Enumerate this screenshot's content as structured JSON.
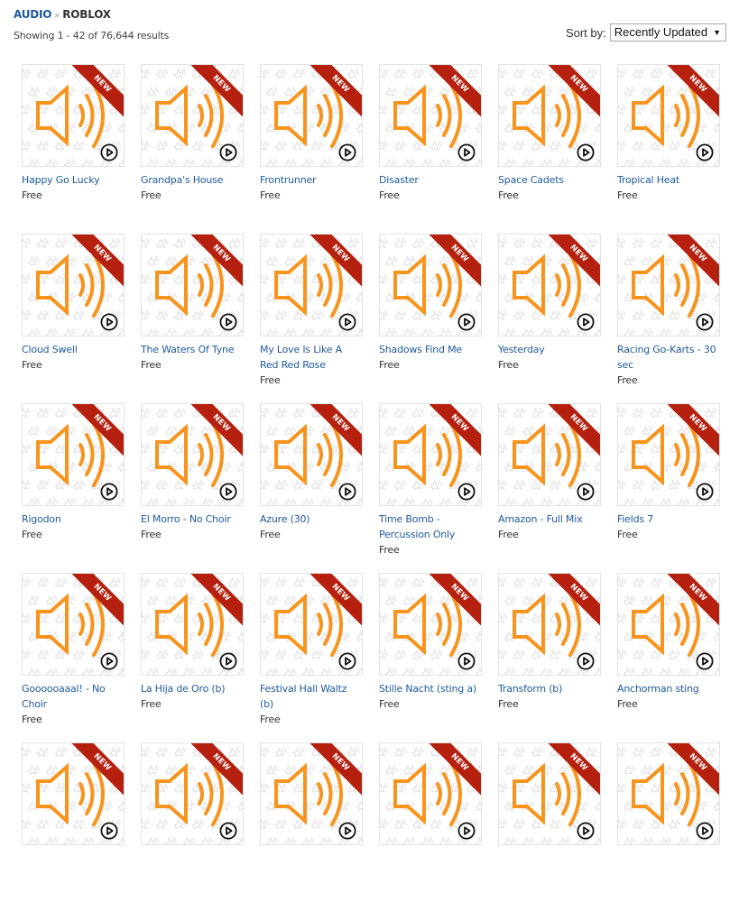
{
  "breadcrumb": {
    "parent": "AUDIO",
    "separator": "»",
    "current": "ROBLOX"
  },
  "results": {
    "text": "Showing 1 - 42 of 76,644 results"
  },
  "sort": {
    "label": "Sort by:",
    "selected": "Recently Updated",
    "arrow": "▼"
  },
  "badge_label": "NEW",
  "colors": {
    "link": "#1e5a9c",
    "ribbon": "#b5200f",
    "speaker": "#f7941d"
  },
  "items": [
    {
      "title": "Happy Go Lucky",
      "price": "Free"
    },
    {
      "title": "Grandpa's House",
      "price": "Free"
    },
    {
      "title": "Frontrunner",
      "price": "Free"
    },
    {
      "title": "Disaster",
      "price": "Free"
    },
    {
      "title": "Space Cadets",
      "price": "Free"
    },
    {
      "title": "Tropical Heat",
      "price": "Free"
    },
    {
      "title": "Cloud Swell",
      "price": "Free"
    },
    {
      "title": "The Waters Of Tyne",
      "price": "Free"
    },
    {
      "title": "My Love Is Like A Red Red Rose",
      "price": "Free"
    },
    {
      "title": "Shadows Find Me",
      "price": "Free"
    },
    {
      "title": "Yesterday",
      "price": "Free"
    },
    {
      "title": "Racing Go-Karts - 30 sec",
      "price": "Free"
    },
    {
      "title": "Rigodon",
      "price": "Free"
    },
    {
      "title": "El Morro - No Choir",
      "price": "Free"
    },
    {
      "title": "Azure (30)",
      "price": "Free"
    },
    {
      "title": "Time Bomb - Percussion Only",
      "price": "Free"
    },
    {
      "title": "Amazon - Full Mix",
      "price": "Free"
    },
    {
      "title": "Fields 7",
      "price": "Free"
    },
    {
      "title": "Goooooaaal! - No Choir",
      "price": "Free"
    },
    {
      "title": "La Hija de Oro (b)",
      "price": "Free"
    },
    {
      "title": "Festival Hall Waltz (b)",
      "price": "Free"
    },
    {
      "title": "Stille Nacht (sting a)",
      "price": "Free"
    },
    {
      "title": "Transform (b)",
      "price": "Free"
    },
    {
      "title": "Anchorman sting",
      "price": "Free"
    },
    {
      "title": "",
      "price": ""
    },
    {
      "title": "",
      "price": ""
    },
    {
      "title": "",
      "price": ""
    },
    {
      "title": "",
      "price": ""
    },
    {
      "title": "",
      "price": ""
    },
    {
      "title": "",
      "price": ""
    }
  ]
}
